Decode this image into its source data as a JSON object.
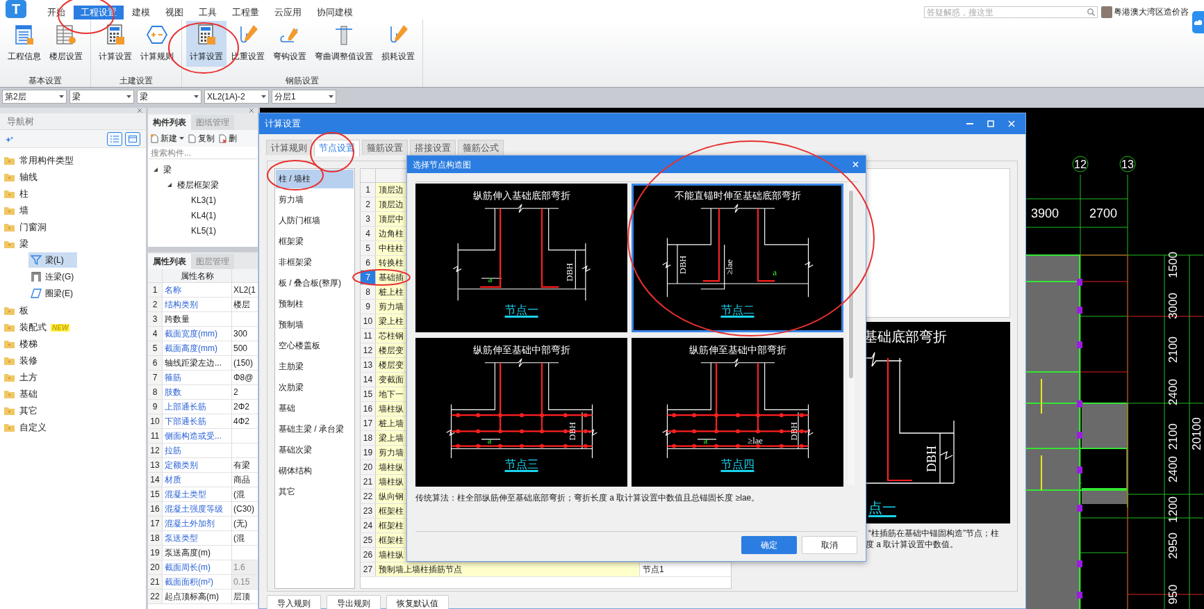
{
  "app": {
    "logo": "T",
    "tabs": [
      {
        "label": "开始",
        "selected": false
      },
      {
        "label": "工程设置",
        "selected": true
      },
      {
        "label": "建模",
        "selected": false
      },
      {
        "label": "视图",
        "selected": false
      },
      {
        "label": "工具",
        "selected": false
      },
      {
        "label": "工程量",
        "selected": false
      },
      {
        "label": "云应用",
        "selected": false
      },
      {
        "label": "协同建模",
        "selected": false
      }
    ],
    "search": {
      "placeholder": "答疑解惑，搜这里"
    },
    "user": "粤港澳大湾区造价咨"
  },
  "ribbon": {
    "groups": [
      {
        "label": "基本设置",
        "buttons": [
          {
            "label": "工程信息",
            "selected": false
          },
          {
            "label": "楼层设置",
            "selected": false
          }
        ]
      },
      {
        "label": "土建设置",
        "buttons": [
          {
            "label": "计算设置",
            "selected": false
          },
          {
            "label": "计算规则",
            "selected": false
          }
        ]
      },
      {
        "label": "钢筋设置",
        "buttons": [
          {
            "label": "计算设置",
            "selected": true
          },
          {
            "label": "比重设置",
            "selected": false
          },
          {
            "label": "弯钩设置",
            "selected": false
          },
          {
            "label": "弯曲调整值设置",
            "selected": false
          },
          {
            "label": "损耗设置",
            "selected": false
          }
        ]
      }
    ]
  },
  "selectors": [
    "第2层",
    "梁",
    "梁",
    "XL2(1A)-2",
    "分层1"
  ],
  "nav_tree": {
    "title": "导航树",
    "items": [
      {
        "label": "常用构件类型",
        "expanded": false
      },
      {
        "label": "轴线",
        "expanded": false
      },
      {
        "label": "柱",
        "expanded": false
      },
      {
        "label": "墙",
        "expanded": false
      },
      {
        "label": "门窗洞",
        "expanded": false
      },
      {
        "label": "梁",
        "expanded": true,
        "children": [
          {
            "label": "梁(L)",
            "selected": true
          },
          {
            "label": "连梁(G)",
            "selected": false
          },
          {
            "label": "圈梁(E)",
            "selected": false
          }
        ]
      },
      {
        "label": "板",
        "expanded": false
      },
      {
        "label": "装配式",
        "expanded": false,
        "badge": "NEW"
      },
      {
        "label": "楼梯",
        "expanded": false
      },
      {
        "label": "装修",
        "expanded": false
      },
      {
        "label": "土方",
        "expanded": false
      },
      {
        "label": "基础",
        "expanded": false
      },
      {
        "label": "其它",
        "expanded": false
      },
      {
        "label": "自定义",
        "expanded": false
      }
    ]
  },
  "component_list": {
    "tabs": [
      {
        "label": "构件列表",
        "selected": true
      },
      {
        "label": "图纸管理",
        "selected": false
      }
    ],
    "toolbar": [
      "新建",
      "复制",
      "删"
    ],
    "search": {
      "placeholder": "搜索构件..."
    },
    "tree": [
      {
        "label": "梁",
        "children": [
          {
            "label": "楼层框架梁",
            "children": [
              {
                "label": "KL3(1)"
              },
              {
                "label": "KL4(1)"
              },
              {
                "label": "KL5(1)"
              }
            ]
          }
        ]
      }
    ]
  },
  "properties": {
    "tabs": [
      {
        "label": "属性列表",
        "selected": true
      },
      {
        "label": "图层管理",
        "selected": false
      }
    ],
    "header": "属性名称",
    "rows": [
      {
        "index": "1",
        "name": "名称",
        "value": "XL2(1",
        "link": true,
        "readonly": false
      },
      {
        "index": "2",
        "name": "结构类别",
        "value": "楼层",
        "link": true,
        "readonly": false
      },
      {
        "index": "3",
        "name": "跨数量",
        "link": false,
        "readonly": false
      },
      {
        "index": "4",
        "name": "截面宽度(mm)",
        "value": "300",
        "link": true,
        "readonly": false
      },
      {
        "index": "5",
        "name": "截面高度(mm)",
        "value": "500",
        "link": true,
        "readonly": false
      },
      {
        "index": "6",
        "name": "轴线距梁左边...",
        "value": "(150)",
        "link": false,
        "readonly": false
      },
      {
        "index": "7",
        "name": "箍筋",
        "value": "Φ8@",
        "link": true,
        "readonly": false
      },
      {
        "index": "8",
        "name": "肢数",
        "value": "2",
        "link": true,
        "readonly": false
      },
      {
        "index": "9",
        "name": "上部通长筋",
        "value": "2Φ2",
        "link": true,
        "readonly": false
      },
      {
        "index": "10",
        "name": "下部通长筋",
        "value": "4Φ2",
        "link": true,
        "readonly": false
      },
      {
        "index": "11",
        "name": "侧面构造或受...",
        "link": true,
        "readonly": false
      },
      {
        "index": "12",
        "name": "拉筋",
        "link": true,
        "readonly": false
      },
      {
        "index": "13",
        "name": "定额类别",
        "value": "有梁",
        "link": true,
        "readonly": false
      },
      {
        "index": "14",
        "name": "材质",
        "value": "商品",
        "link": true,
        "readonly": false
      },
      {
        "index": "15",
        "name": "混凝土类型",
        "value": "(混",
        "link": true,
        "readonly": false
      },
      {
        "index": "16",
        "name": "混凝土强度等级",
        "value": "(C30)",
        "link": true,
        "readonly": false
      },
      {
        "index": "17",
        "name": "混凝土外加剂",
        "value": "(无)",
        "link": true,
        "readonly": false
      },
      {
        "index": "18",
        "name": "泵送类型",
        "value": "(混",
        "link": true,
        "readonly": false
      },
      {
        "index": "19",
        "name": "泵送高度(m)",
        "link": false,
        "readonly": false
      },
      {
        "index": "20",
        "name": "截面周长(m)",
        "value": "1.6",
        "link": true,
        "readonly": true
      },
      {
        "index": "21",
        "name": "截面面积(m²)",
        "value": "0.15",
        "link": true,
        "readonly": true
      },
      {
        "index": "22",
        "name": "起点顶标高(m)",
        "value": "层顶",
        "link": false,
        "readonly": false
      }
    ]
  },
  "calc_dialog": {
    "title": "计算设置",
    "tabs": [
      {
        "label": "计算规则",
        "selected": false
      },
      {
        "label": "节点设置",
        "selected": true
      },
      {
        "label": "箍筋设置",
        "selected": false
      },
      {
        "label": "搭接设置",
        "selected": false
      },
      {
        "label": "箍筋公式",
        "selected": false
      }
    ],
    "categories": [
      {
        "label": "柱 / 墙柱",
        "selected": true
      },
      {
        "label": "剪力墙",
        "selected": false
      },
      {
        "label": "人防门框墙",
        "selected": false
      },
      {
        "label": "框架梁",
        "selected": false
      },
      {
        "label": "非框架梁",
        "selected": false
      },
      {
        "label": "板 / 叠合板(整厚)",
        "selected": false
      },
      {
        "label": "预制柱",
        "selected": false
      },
      {
        "label": "预制墙",
        "selected": false
      },
      {
        "label": "空心楼盖板",
        "selected": false
      },
      {
        "label": "主肋梁",
        "selected": false
      },
      {
        "label": "次肋梁",
        "selected": false
      },
      {
        "label": "基础",
        "selected": false
      },
      {
        "label": "基础主梁 / 承台梁",
        "selected": false
      },
      {
        "label": "基础次梁",
        "selected": false
      },
      {
        "label": "砌体结构",
        "selected": false
      },
      {
        "label": "其它",
        "selected": false
      }
    ],
    "rows": [
      {
        "index": "1",
        "name": "顶层边",
        "selected": false
      },
      {
        "index": "2",
        "name": "顶层边",
        "selected": false
      },
      {
        "index": "3",
        "name": "顶层中",
        "selected": false
      },
      {
        "index": "4",
        "name": "边角柱",
        "selected": false
      },
      {
        "index": "5",
        "name": "中柱柱",
        "selected": false
      },
      {
        "index": "6",
        "name": "转换柱",
        "selected": false
      },
      {
        "index": "7",
        "name": "基础插",
        "selected": true
      },
      {
        "index": "8",
        "name": "桩上柱",
        "selected": false
      },
      {
        "index": "9",
        "name": "剪力墙",
        "selected": false
      },
      {
        "index": "10",
        "name": "梁上柱",
        "selected": false
      },
      {
        "index": "11",
        "name": "芯柱钢",
        "selected": false
      },
      {
        "index": "12",
        "name": "楼层变",
        "selected": false
      },
      {
        "index": "13",
        "name": "楼层变",
        "selected": false
      },
      {
        "index": "14",
        "name": "变截面",
        "selected": false
      },
      {
        "index": "15",
        "name": "地下一",
        "selected": false
      },
      {
        "index": "16",
        "name": "墙柱纵",
        "selected": false
      },
      {
        "index": "17",
        "name": "桩上墙",
        "selected": false
      },
      {
        "index": "18",
        "name": "梁上墙",
        "selected": false
      },
      {
        "index": "19",
        "name": "剪力墙",
        "selected": false
      },
      {
        "index": "20",
        "name": "墙柱纵",
        "selected": false
      },
      {
        "index": "21",
        "name": "墙柱纵",
        "selected": false
      },
      {
        "index": "22",
        "name": "纵向钢",
        "selected": false
      },
      {
        "index": "23",
        "name": "框架柱",
        "selected": false
      },
      {
        "index": "24",
        "name": "框架柱",
        "selected": false
      },
      {
        "index": "25",
        "name": "框架柱",
        "selected": false
      },
      {
        "index": "26",
        "name": "墙柱纵",
        "selected": false
      },
      {
        "index": "27",
        "name": "预制墙上墙柱插筋节点",
        "value": "节点1",
        "selected": false
      }
    ],
    "preview": {
      "title": "基础底部弯折",
      "mark": "DBH",
      "label": "点一"
    },
    "description": [
      "“柱插筋在基础中锚固构造”节点；柱",
      "度 a 取计算设置中数值。"
    ],
    "buttons": [
      "导入规则",
      "导出规则",
      "恢复默认值"
    ]
  },
  "node_dialog": {
    "title": "选择节点构造图",
    "nodes": [
      {
        "title": "纵筋伸入基础底部弯折",
        "label": "节点一",
        "kind": "bottom",
        "selected": false,
        "marks": [
          "a",
          "DBH"
        ]
      },
      {
        "title": "不能直锚时伸至基础底部弯折",
        "label": "节点二",
        "kind": "straight",
        "selected": true,
        "marks": [
          "DBH",
          "≥lae",
          "a"
        ]
      },
      {
        "title": "纵筋伸至基础中部弯折",
        "label": "节点三",
        "kind": "middle",
        "selected": false,
        "marks": [
          "a",
          "DBH"
        ]
      },
      {
        "title": "纵筋伸至基础中部弯折",
        "label": "节点四",
        "kind": "middle",
        "selected": false,
        "marks": [
          "a",
          "≥lae",
          "DBH"
        ]
      }
    ],
    "description": "传统算法：柱全部纵筋伸至基础底部弯折；弯折长度 a 取计算设置中数值且总锚固长度 ≥lae。",
    "buttons": [
      {
        "label": "确定",
        "primary": true
      },
      {
        "label": "取消",
        "primary": false
      }
    ]
  },
  "cad": {
    "axes": [
      "12",
      "13"
    ],
    "spans": [
      "3900",
      "2700"
    ],
    "heights": [
      "1500",
      "3000",
      "2100",
      "2400",
      "2100",
      "2400",
      "1200",
      "2950",
      "950"
    ],
    "total": "20100"
  }
}
